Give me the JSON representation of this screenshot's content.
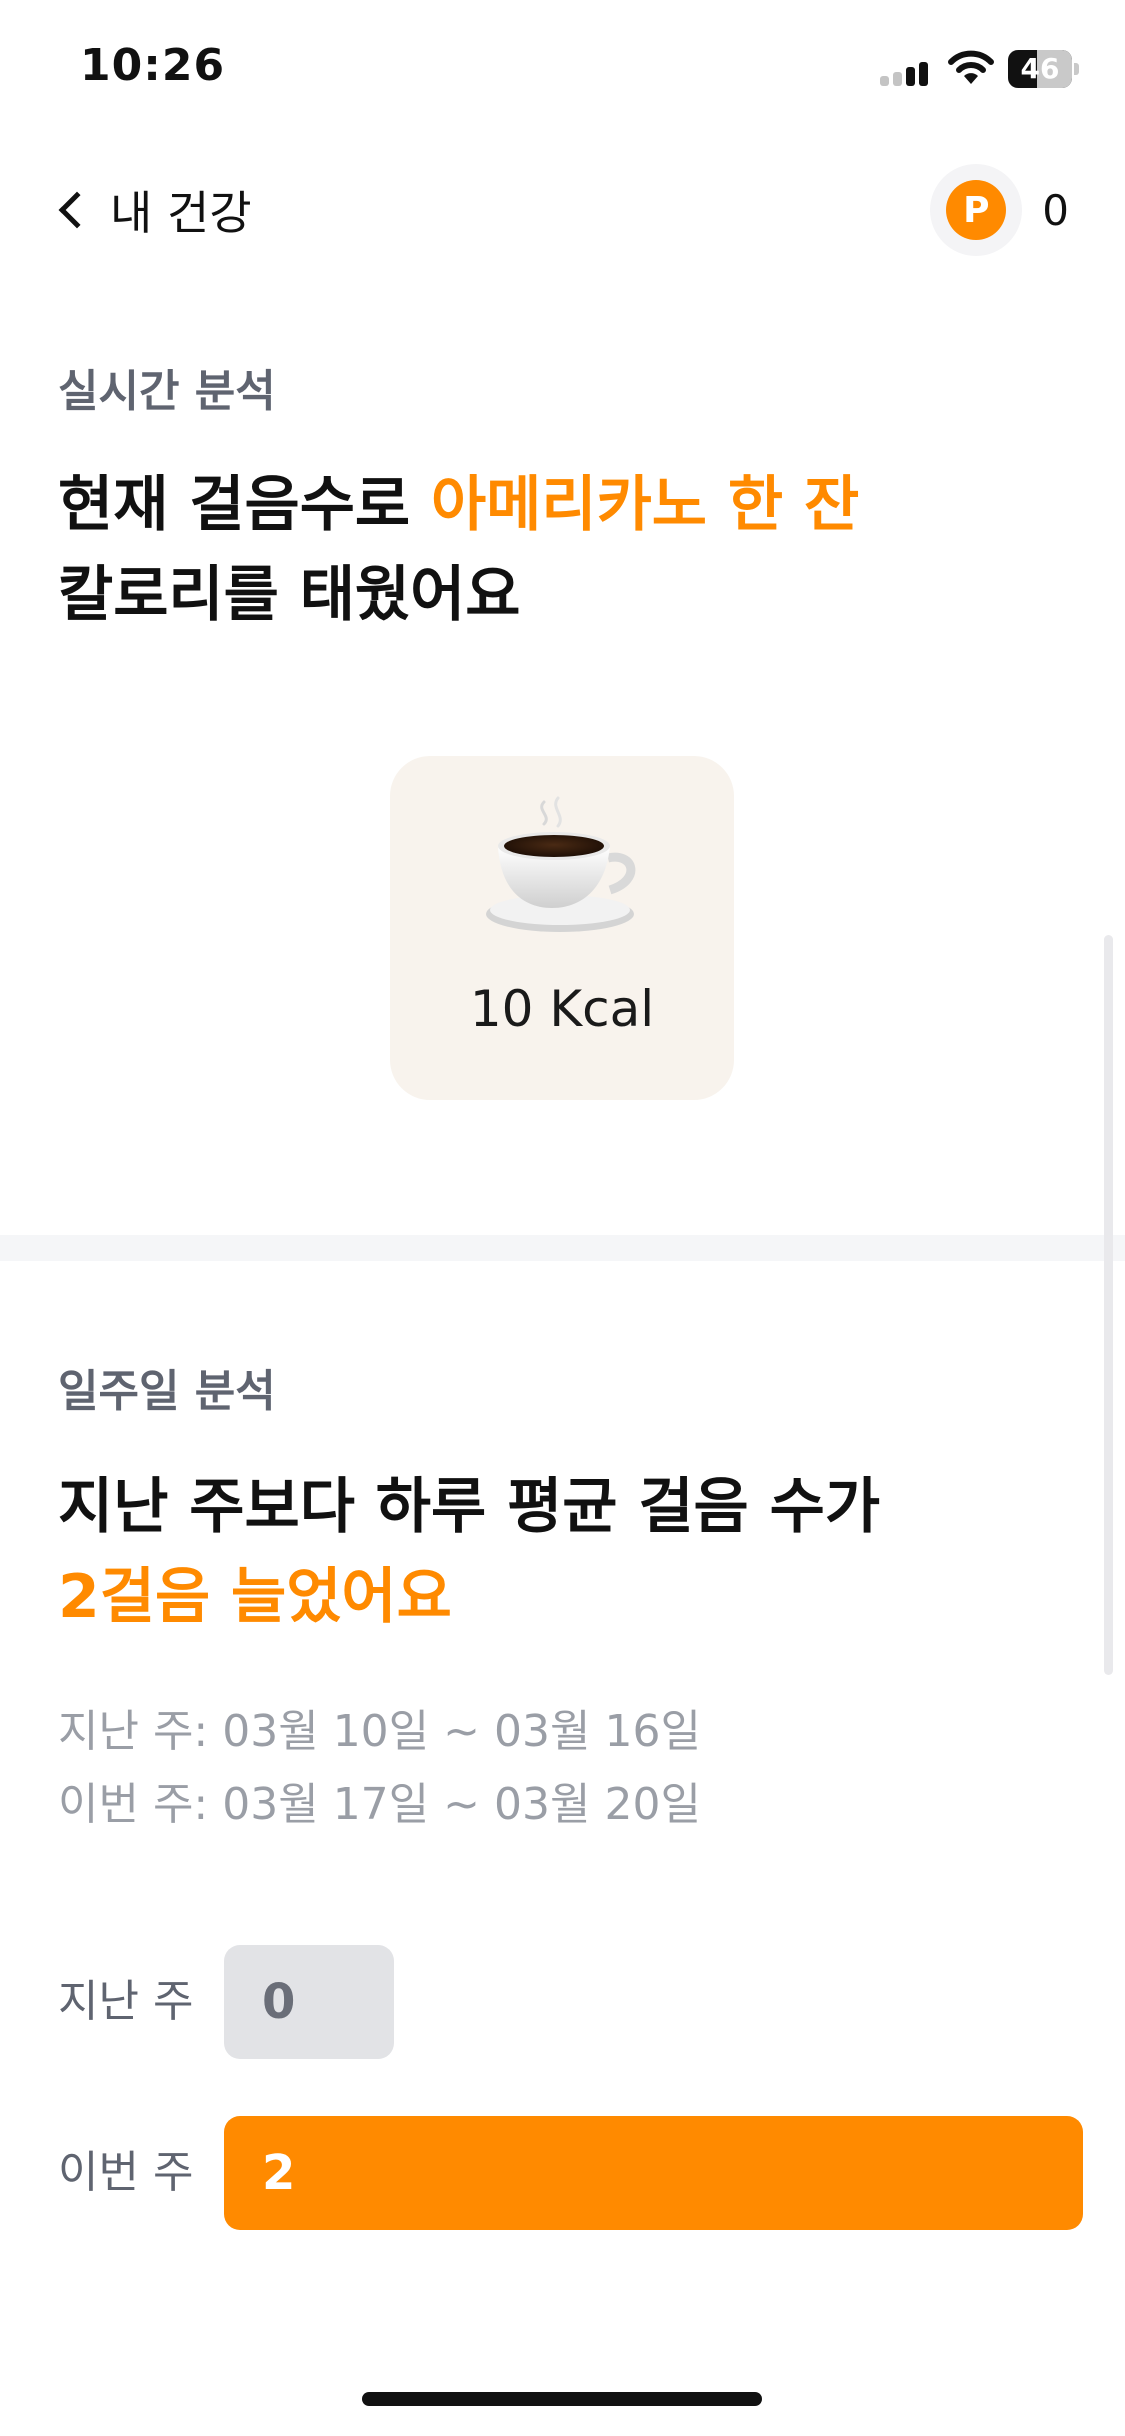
{
  "status_bar": {
    "time": "10:26",
    "battery": "46",
    "battery_level": 0.46
  },
  "nav": {
    "back_label": "내 건강",
    "point_icon_letter": "P",
    "point_count": "0"
  },
  "realtime": {
    "label": "실시간 분석",
    "headline_prefix": "현재 걸음수로 ",
    "headline_accent": "아메리카노 한 잔",
    "headline_line2": "칼로리를 태웠어요",
    "kcal_text": "10 Kcal",
    "food_icon": "coffee-cup-icon"
  },
  "weekly": {
    "label": "일주일 분석",
    "headline_line1": "지난 주보다 하루 평균 걸음 수가",
    "headline_line2": "2걸음 늘었어요",
    "last_week_range": "지난 주: 03월 10일 ~ 03월 16일",
    "this_week_range": "이번 주: 03월 17일 ~ 03월 20일"
  },
  "comparison": {
    "max_value": 2,
    "rows": [
      {
        "label": "지난 주",
        "value": 0,
        "value_text": "0",
        "bar_color": "#e2e3e6",
        "text_color": "#6a6e78"
      },
      {
        "label": "이번 주",
        "value": 2,
        "value_text": "2",
        "bar_color": "#ff8a00",
        "text_color": "#ffffff"
      }
    ]
  },
  "colors": {
    "accent": "#ff8a00",
    "card_bg": "#f8f3ed"
  }
}
